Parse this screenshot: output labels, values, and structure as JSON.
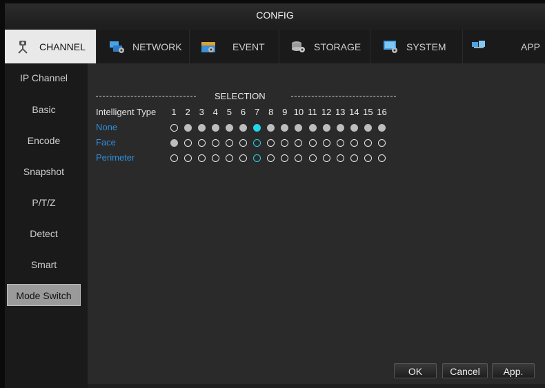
{
  "window": {
    "title": "CONFIG"
  },
  "tabs": [
    {
      "label": "CHANNEL",
      "icon": "camera-icon"
    },
    {
      "label": "NETWORK",
      "icon": "network-icon"
    },
    {
      "label": "EVENT",
      "icon": "event-icon"
    },
    {
      "label": "STORAGE",
      "icon": "storage-icon"
    },
    {
      "label": "SYSTEM",
      "icon": "system-icon"
    },
    {
      "label": "APP",
      "icon": "app-icon"
    }
  ],
  "sidebar": {
    "items": [
      {
        "label": "IP Channel"
      },
      {
        "label": "Basic"
      },
      {
        "label": "Encode"
      },
      {
        "label": "Snapshot"
      },
      {
        "label": "P/T/Z"
      },
      {
        "label": "Detect"
      },
      {
        "label": "Smart"
      },
      {
        "label": "Mode Switch",
        "active": true
      }
    ]
  },
  "selection": {
    "title": "SELECTION",
    "type_label": "Intelligent Type",
    "channels": [
      "1",
      "2",
      "3",
      "4",
      "5",
      "6",
      "7",
      "8",
      "9",
      "10",
      "11",
      "12",
      "13",
      "14",
      "15",
      "16"
    ],
    "highlight_channel": 7,
    "rows": [
      {
        "label": "None",
        "states": [
          0,
          1,
          1,
          1,
          1,
          1,
          1,
          1,
          1,
          1,
          1,
          1,
          1,
          1,
          1,
          1
        ]
      },
      {
        "label": "Face",
        "states": [
          1,
          0,
          0,
          0,
          0,
          0,
          0,
          0,
          0,
          0,
          0,
          0,
          0,
          0,
          0,
          0
        ]
      },
      {
        "label": "Perimeter",
        "states": [
          0,
          0,
          0,
          0,
          0,
          0,
          0,
          0,
          0,
          0,
          0,
          0,
          0,
          0,
          0,
          0
        ]
      }
    ]
  },
  "buttons": {
    "ok": "OK",
    "cancel": "Cancel",
    "apply": "App."
  },
  "colors": {
    "accent": "#22d6e8",
    "label_blue": "#2f8fe0"
  }
}
